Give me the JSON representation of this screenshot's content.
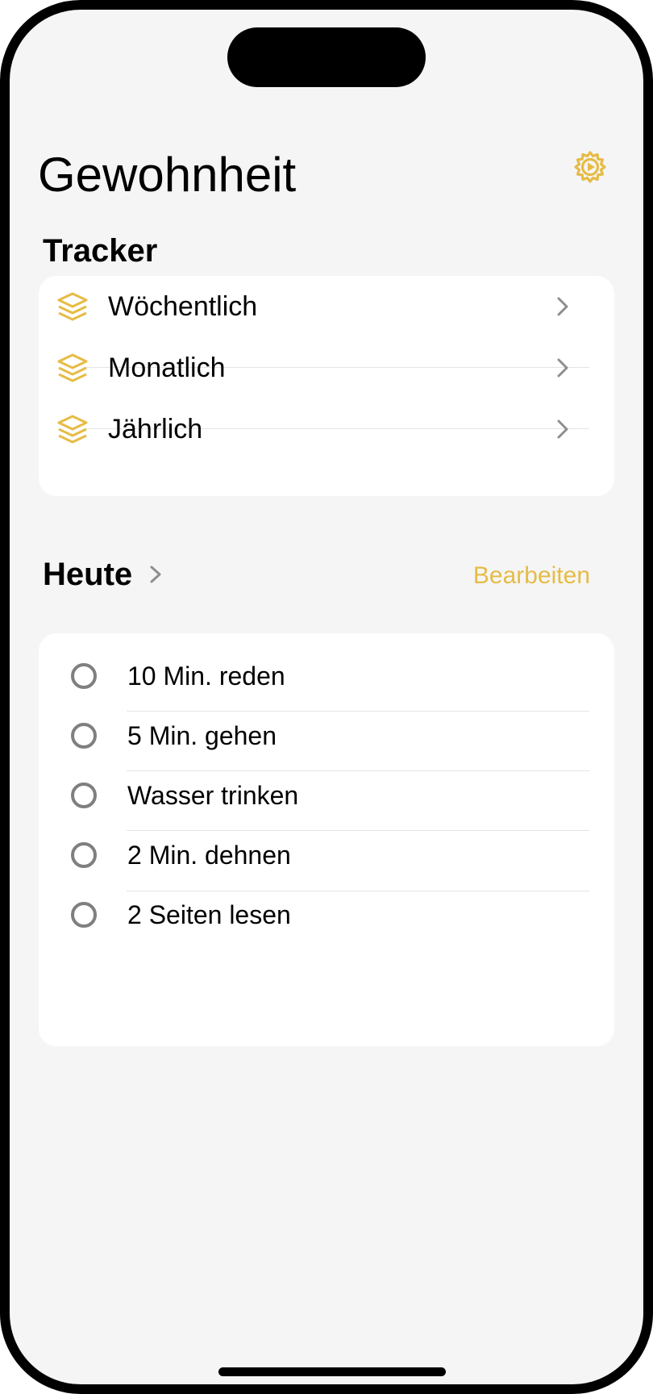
{
  "colors": {
    "accent": "#e6bc45",
    "background": "#f5f5f5",
    "card": "#ffffff",
    "radio_outline": "#7f7f7f",
    "chevron": "#8e8e8e"
  },
  "header": {
    "title": "Gewohnheit",
    "settings_icon": "gear-icon"
  },
  "tracker": {
    "title": "Tracker",
    "items": [
      {
        "label": "Wöchentlich",
        "icon": "stack-icon"
      },
      {
        "label": "Monatlich",
        "icon": "stack-icon"
      },
      {
        "label": "Jährlich",
        "icon": "stack-icon"
      }
    ]
  },
  "today": {
    "title": "Heute",
    "edit_label": "Bearbeiten",
    "habits": [
      {
        "label": "10 Min. reden",
        "done": false
      },
      {
        "label": "5 Min. gehen",
        "done": false
      },
      {
        "label": "Wasser trinken",
        "done": false
      },
      {
        "label": "2 Min. dehnen",
        "done": false
      },
      {
        "label": "2 Seiten lesen",
        "done": false
      }
    ]
  }
}
